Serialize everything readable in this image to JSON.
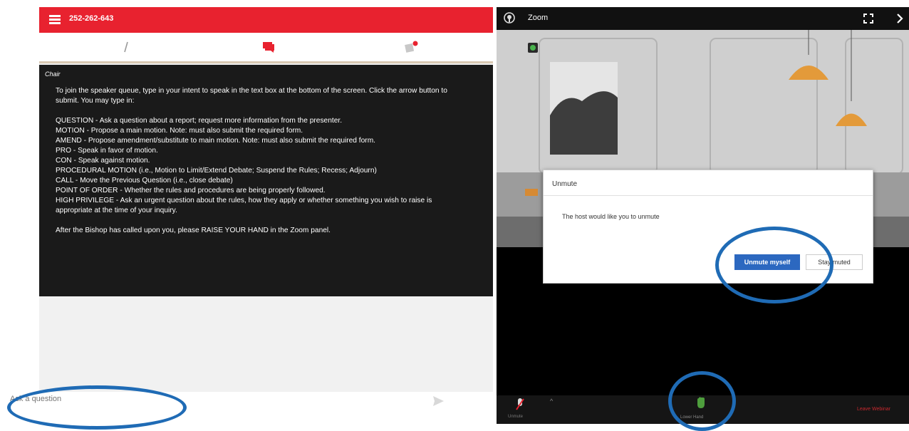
{
  "left": {
    "meeting_id": "252-262-643",
    "chair_label": "Chair",
    "instructions": {
      "intro": "To join the speaker queue, type in your intent to speak in the text box at the bottom of the screen. Click the arrow button to submit. You may type in:",
      "question": "QUESTION - Ask a question about a report; request more information from the presenter.",
      "motion": "MOTION - Propose a main motion.  Note: must also submit the required form.",
      "amend": "AMEND - Propose amendment/substitute to main motion.  Note: must also submit the required form.",
      "pro": "PRO - Speak in favor of motion.",
      "con": "CON - Speak against motion.",
      "procedural": "PROCEDURAL MOTION (i.e., Motion to Limit/Extend Debate; Suspend the Rules; Recess; Adjourn)",
      "call": "CALL - Move the Previous Question (i.e., close debate)",
      "point_of_order": "POINT OF ORDER - Whether the rules and procedures are being properly followed.",
      "high_privilege": "HIGH PRIVILEGE - Ask an urgent question about the rules, how they apply or whether something you wish to raise is appropriate at the time of your inquiry.",
      "after": "After the Bishop has called upon you, please RAISE YOUR HAND in the Zoom panel."
    },
    "input_placeholder": "Ask a question",
    "icons": [
      "menu-icon",
      "info-icon",
      "chat-icon",
      "notes-icon",
      "send-icon"
    ],
    "accent_color": "#e8222f"
  },
  "zoom": {
    "title": "Zoom",
    "dialog": {
      "title": "Unmute",
      "message": "The host would like you to unmute",
      "unmute_label": "Unmute myself",
      "stay_label": "Stay muted"
    },
    "controls": {
      "unmute_label": "Unmute",
      "lower_hand_label": "Lower Hand",
      "leave_label": "Leave Webinar"
    },
    "icons": [
      "zoom-logo-icon",
      "fullscreen-icon",
      "chevron-right-icon",
      "shield-icon",
      "mic-icon",
      "hand-icon"
    ],
    "accent_color": "#2c68c0"
  }
}
